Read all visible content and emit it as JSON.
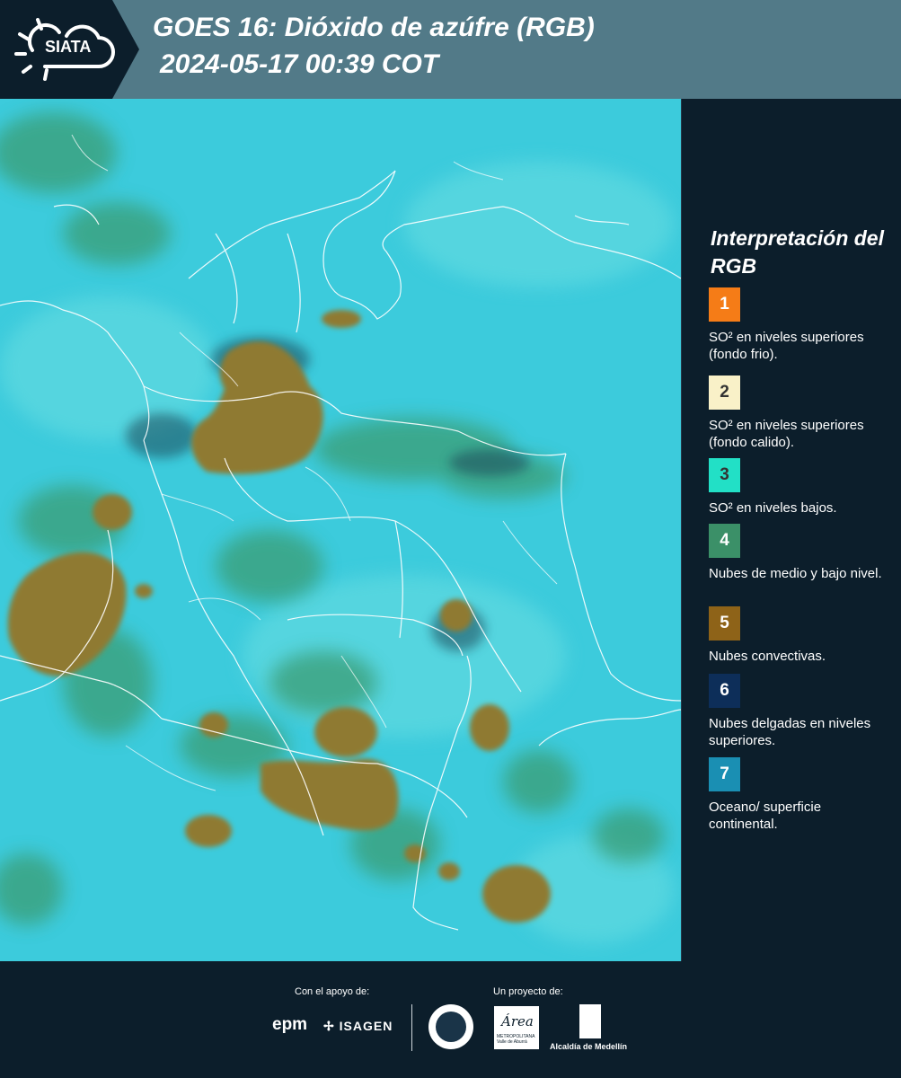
{
  "header": {
    "logo": "SIATA",
    "title_line1": "GOES 16: Dióxido de azúfre (RGB)",
    "title_line2": "2024-05-17 00:39 COT",
    "colors": {
      "dark": "#0c1e2b",
      "band": "#527a88"
    }
  },
  "map": {
    "description_icon": "satellite-rgb-map",
    "colors": {
      "ocean": "#39c7da",
      "convective": "#8f7a33",
      "mid_low": "#3c9a6a",
      "thin_high": "#0c2a45",
      "borders": "#ffffff"
    }
  },
  "legend": {
    "title": "Interpretación del RGB",
    "items": [
      {
        "number": "1",
        "color": "#f57c17",
        "label": "SO² en niveles superiores (fondo frio)."
      },
      {
        "number": "2",
        "color": "#f9f1c8",
        "label": "SO² en niveles superiores (fondo calido)."
      },
      {
        "number": "3",
        "color": "#22e0c6",
        "label": "SO² en niveles bajos."
      },
      {
        "number": "4",
        "color": "#3b9068",
        "label": "Nubes de medio y bajo nivel."
      },
      {
        "number": "5",
        "color": "#8e6318",
        "label": "Nubes convectivas."
      },
      {
        "number": "6",
        "color": "#0d2e59",
        "label": "Nubes delgadas en niveles superiores."
      },
      {
        "number": "7",
        "color": "#1a8fb3",
        "label": "Oceano/ superficie continental."
      }
    ]
  },
  "footer": {
    "support_label": "Con el apoyo de:",
    "project_label": "Un proyecto de:",
    "sponsor1": "epm",
    "sponsor2": "ISAGEN",
    "area_logo": "Área",
    "area_sub": "METROPOLITANA Valle de Aburrá",
    "alcaldia": "Alcaldía de Medellín"
  }
}
